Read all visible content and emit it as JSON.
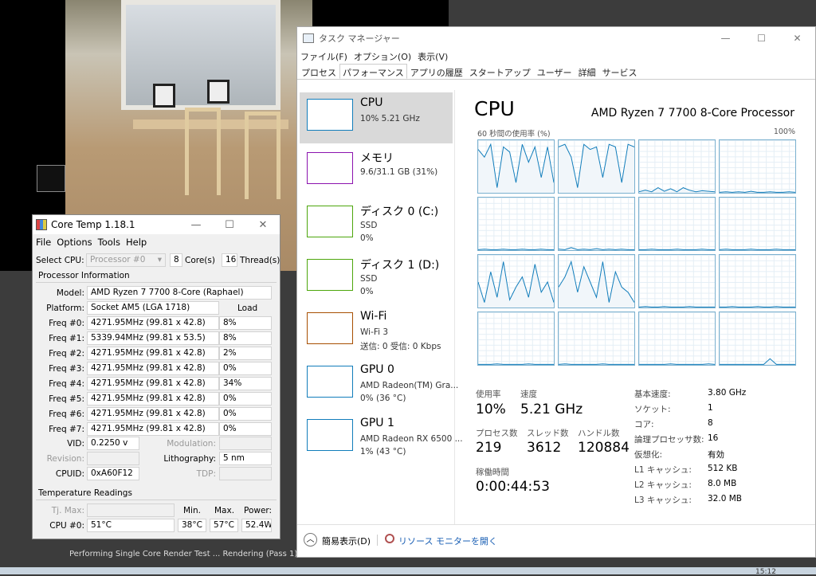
{
  "background": {
    "render_status": "Performing Single Core Render Test ... Rendering (Pass 1)",
    "clock": "15:12"
  },
  "coretemp": {
    "title": "Core Temp 1.18.1",
    "menu": [
      "File",
      "Options",
      "Tools",
      "Help"
    ],
    "select_cpu_label": "Select CPU:",
    "processor_select": "Processor #0",
    "cores_value": "8",
    "cores_label": "Core(s)",
    "threads_value": "16",
    "threads_label": "Thread(s)",
    "proc_info_title": "Processor Information",
    "model_label": "Model:",
    "model_value": "AMD Ryzen 7 7700 8-Core (Raphael)",
    "platform_label": "Platform:",
    "platform_value": "Socket AM5 (LGA 1718)",
    "load_header": "Load",
    "freqs": [
      {
        "label": "Freq #0:",
        "value": "4271.95MHz (99.81 x 42.8)",
        "load": "8%"
      },
      {
        "label": "Freq #1:",
        "value": "5339.94MHz (99.81 x 53.5)",
        "load": "8%"
      },
      {
        "label": "Freq #2:",
        "value": "4271.95MHz (99.81 x 42.8)",
        "load": "2%"
      },
      {
        "label": "Freq #3:",
        "value": "4271.95MHz (99.81 x 42.8)",
        "load": "0%"
      },
      {
        "label": "Freq #4:",
        "value": "4271.95MHz (99.81 x 42.8)",
        "load": "34%"
      },
      {
        "label": "Freq #5:",
        "value": "4271.95MHz (99.81 x 42.8)",
        "load": "0%"
      },
      {
        "label": "Freq #6:",
        "value": "4271.95MHz (99.81 x 42.8)",
        "load": "0%"
      },
      {
        "label": "Freq #7:",
        "value": "4271.95MHz (99.81 x 42.8)",
        "load": "0%"
      }
    ],
    "vid_label": "VID:",
    "vid_value": "0.2250 v",
    "modulation_label": "Modulation:",
    "revision_label": "Revision:",
    "lithography_label": "Lithography:",
    "lithography_value": "5 nm",
    "cpuid_label": "CPUID:",
    "cpuid_value": "0xA60F12",
    "tdp_label": "TDP:",
    "temp_title": "Temperature Readings",
    "tjmax_label": "Tj. Max:",
    "min_header": "Min.",
    "max_header": "Max.",
    "power_header": "Power:",
    "cpu0_label": "CPU #0:",
    "cpu0_temp": "51°C",
    "cpu0_min": "38°C",
    "cpu0_max": "57°C",
    "cpu0_power": "52.4W"
  },
  "taskmgr": {
    "title": "タスク マネージャー",
    "menu": [
      "ファイル(F)",
      "オプション(O)",
      "表示(V)"
    ],
    "tabs": [
      "プロセス",
      "パフォーマンス",
      "アプリの履歴",
      "スタートアップ",
      "ユーザー",
      "詳細",
      "サービス"
    ],
    "active_tab": "パフォーマンス",
    "sidebar": [
      {
        "name": "CPU",
        "sub1": "10%  5.21 GHz",
        "sub2": "",
        "color": "#117dbb"
      },
      {
        "name": "メモリ",
        "sub1": "9.6/31.1 GB (31%)",
        "sub2": "",
        "color": "#8b12ae"
      },
      {
        "name": "ディスク 0 (C:)",
        "sub1": "SSD",
        "sub2": "0%",
        "color": "#4da60c"
      },
      {
        "name": "ディスク 1 (D:)",
        "sub1": "SSD",
        "sub2": "0%",
        "color": "#4da60c"
      },
      {
        "name": "Wi-Fi",
        "sub1": "Wi-Fi 3",
        "sub2": "送信: 0  受信: 0 Kbps",
        "color": "#a74f01"
      },
      {
        "name": "GPU 0",
        "sub1": "AMD Radeon(TM) Gra...",
        "sub2": "0% (36 °C)",
        "color": "#117dbb"
      },
      {
        "name": "GPU 1",
        "sub1": "AMD Radeon RX 6500 ...",
        "sub2": "1% (43 °C)",
        "color": "#117dbb"
      }
    ],
    "main_title": "CPU",
    "cpu_model": "AMD Ryzen 7 7700 8-Core Processor",
    "util_label": "60 秒間の使用率 (%)",
    "util_max": "100%",
    "core_activity": [
      [
        0.85,
        0.7,
        0.95,
        0.1,
        0.9,
        0.8,
        0.2,
        0.95,
        0.6,
        0.9,
        0.3,
        0.9,
        0.2
      ],
      [
        0.9,
        0.95,
        0.7,
        0.1,
        0.95,
        0.85,
        0.9,
        0.3,
        0.95,
        0.9,
        0.2,
        0.95,
        0.9
      ],
      [
        0.02,
        0.05,
        0.02,
        0.1,
        0.03,
        0.08,
        0.02,
        0.1,
        0.05,
        0.02,
        0.04,
        0.03,
        0.02
      ],
      [
        0.01,
        0.02,
        0.01,
        0.02,
        0.01,
        0.03,
        0.01,
        0.01,
        0.02,
        0.01,
        0.01,
        0.02,
        0.01
      ],
      [
        0.01,
        0.02,
        0.01,
        0.01,
        0.02,
        0.01,
        0.01,
        0.02,
        0.01,
        0.01,
        0.02,
        0.01,
        0.01
      ],
      [
        0.02,
        0.01,
        0.05,
        0.01,
        0.02,
        0.01,
        0.03,
        0.01,
        0.02,
        0.01,
        0.02,
        0.01,
        0.01
      ],
      [
        0.01,
        0.01,
        0.02,
        0.01,
        0.01,
        0.01,
        0.02,
        0.01,
        0.01,
        0.01,
        0.02,
        0.01,
        0.01
      ],
      [
        0.01,
        0.02,
        0.01,
        0.01,
        0.01,
        0.02,
        0.01,
        0.01,
        0.01,
        0.02,
        0.01,
        0.01,
        0.01
      ],
      [
        0.5,
        0.1,
        0.7,
        0.2,
        0.9,
        0.15,
        0.4,
        0.6,
        0.2,
        0.85,
        0.3,
        0.5,
        0.1
      ],
      [
        0.4,
        0.6,
        0.9,
        0.3,
        0.8,
        0.5,
        0.2,
        0.9,
        0.1,
        0.7,
        0.4,
        0.3,
        0.1
      ],
      [
        0.01,
        0.02,
        0.01,
        0.01,
        0.02,
        0.01,
        0.01,
        0.01,
        0.02,
        0.01,
        0.01,
        0.01,
        0.01
      ],
      [
        0.01,
        0.01,
        0.02,
        0.01,
        0.01,
        0.01,
        0.02,
        0.01,
        0.01,
        0.02,
        0.01,
        0.01,
        0.01
      ],
      [
        0.01,
        0.01,
        0.01,
        0.02,
        0.01,
        0.01,
        0.01,
        0.01,
        0.02,
        0.01,
        0.01,
        0.01,
        0.01
      ],
      [
        0.01,
        0.02,
        0.01,
        0.01,
        0.01,
        0.01,
        0.01,
        0.02,
        0.01,
        0.01,
        0.01,
        0.01,
        0.01
      ],
      [
        0.01,
        0.01,
        0.01,
        0.01,
        0.01,
        0.02,
        0.01,
        0.01,
        0.01,
        0.01,
        0.01,
        0.02,
        0.01
      ],
      [
        0.01,
        0.01,
        0.01,
        0.01,
        0.01,
        0.01,
        0.01,
        0.01,
        0.12,
        0.01,
        0.01,
        0.01,
        0.01
      ]
    ],
    "stats": {
      "util_label": "使用率",
      "util_value": "10%",
      "speed_label": "速度",
      "speed_value": "5.21 GHz",
      "proc_label": "プロセス数",
      "proc_value": "219",
      "thread_label": "スレッド数",
      "thread_value": "3612",
      "handle_label": "ハンドル数",
      "handle_value": "120884",
      "uptime_label": "稼働時間",
      "uptime_value": "0:00:44:53"
    },
    "info": [
      {
        "label": "基本速度:",
        "value": "3.80 GHz"
      },
      {
        "label": "ソケット:",
        "value": "1"
      },
      {
        "label": "コア:",
        "value": "8"
      },
      {
        "label": "論理プロセッサ数:",
        "value": "16"
      },
      {
        "label": "仮想化:",
        "value": "有効"
      },
      {
        "label": "L1 キャッシュ:",
        "value": "512 KB"
      },
      {
        "label": "L2 キャッシュ:",
        "value": "8.0 MB"
      },
      {
        "label": "L3 キャッシュ:",
        "value": "32.0 MB"
      }
    ],
    "footer_compact": "簡易表示(D)",
    "footer_resmon": "リソース モニターを開く"
  }
}
